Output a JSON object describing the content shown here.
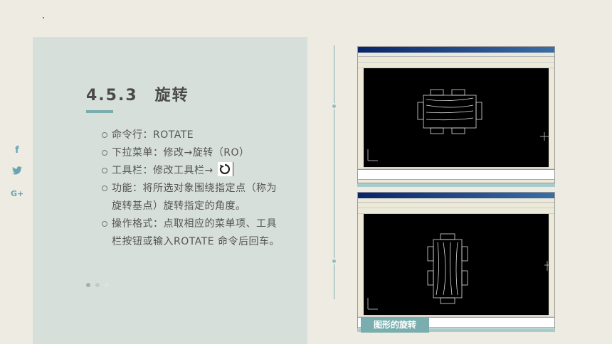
{
  "slide": {
    "title": "4.5.3　旋转",
    "bullets": [
      "命令行：ROTATE",
      "下拉菜单：修改→旋转（RO）",
      "工具栏：修改工具栏→",
      "功能：将所选对象围绕指定点（称为旋转基点）旋转指定的角度。",
      "操作格式：点取相应的菜单项、工具栏按钮或输入ROTATE 命令后回车。"
    ],
    "caption": "图形的旋转"
  },
  "social": {
    "icons": [
      "facebook-icon",
      "twitter-icon",
      "google-plus-icon"
    ],
    "glyphs": [
      "f",
      "🐦",
      "G+"
    ]
  },
  "pager": {
    "count": 3,
    "active": 0
  },
  "colors": {
    "background": "#eeebe3",
    "card": "#d7dfda",
    "accent": "#7aaeae",
    "text": "#555555"
  }
}
